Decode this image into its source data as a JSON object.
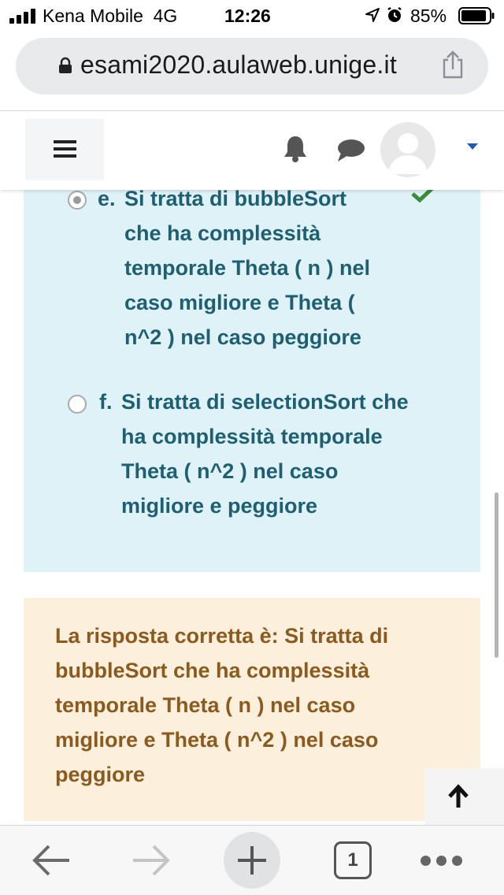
{
  "status_bar": {
    "carrier": "Kena Mobile",
    "network": "4G",
    "time": "12:26",
    "battery": "85%",
    "icons": [
      "signal-icon",
      "location-icon",
      "alarm-icon",
      "battery-icon"
    ]
  },
  "browser": {
    "url": "esami2020.aulaweb.unige.it",
    "icons": [
      "lock-icon",
      "share-icon"
    ]
  },
  "header": {
    "icons": [
      "hamburger-menu-icon",
      "bell-icon",
      "chat-icon",
      "user-avatar",
      "caret-down-icon"
    ]
  },
  "question": {
    "options": [
      {
        "letter": "e.",
        "lines": [
          "Si tratta di bubbleSort",
          "che ha complessità",
          "temporale Theta ( n ) nel",
          "caso migliore e Theta (",
          "n^2 ) nel caso peggiore"
        ],
        "selected": true,
        "correct": true
      },
      {
        "letter": "f.",
        "lines": [
          "Si tratta di selectionSort che",
          "ha complessità temporale",
          "Theta ( n^2 ) nel caso",
          "migliore e peggiore"
        ],
        "selected": false,
        "correct": false
      }
    ]
  },
  "feedback": {
    "text": "La risposta corretta è: Si tratta di\nbubbleSort che ha complessità\ntemporale Theta ( n ) nel caso\nmigliore e Theta ( n^2 ) nel caso\npeggiore"
  },
  "toolbar": {
    "tabs_count": "1",
    "icons": [
      "back-arrow-icon",
      "forward-arrow-icon",
      "new-tab-plus-icon",
      "tabs-icon",
      "more-icon"
    ]
  },
  "colors": {
    "panel_bg": "#def2f8",
    "panel_text": "#1e5f72",
    "feedback_bg": "#fcefdc",
    "feedback_text": "#8a5a1e",
    "check": "#3b8d3a",
    "caret": "#1f5bb5"
  }
}
